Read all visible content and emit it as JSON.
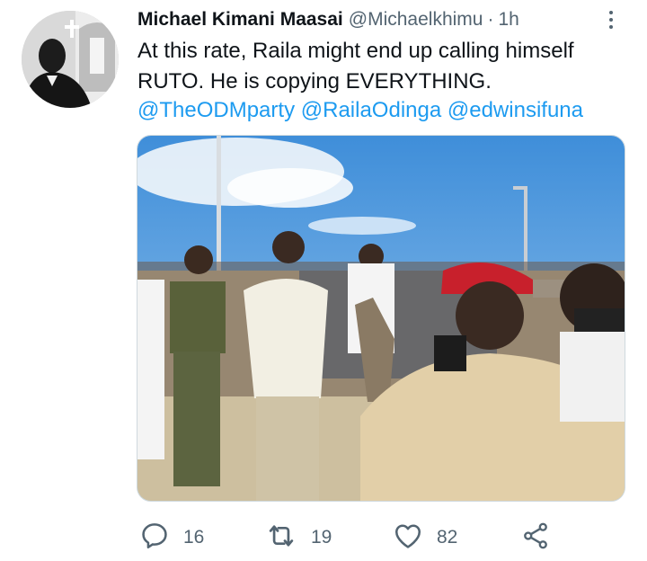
{
  "tweet": {
    "author_name": "Michael Kimani Maasai",
    "handle": "@Michaelkhimu",
    "separator": "·",
    "time": "1h",
    "text_line1": "At this rate, Raila might end up calling himself",
    "text_line2": "RUTO. He is copying EVERYTHING.",
    "mentions": [
      "@TheODMparty",
      "@RailaOdinga",
      "@edwinsifuna"
    ]
  },
  "actions": {
    "reply_count": "16",
    "retweet_count": "19",
    "like_count": "82"
  },
  "icons": {
    "reply": "reply-icon",
    "retweet": "retweet-icon",
    "like": "heart-icon",
    "share": "share-icon",
    "more": "more-icon"
  },
  "colors": {
    "link": "#1d9bf0",
    "secondary_text": "#536471",
    "primary_text": "#0f1419"
  }
}
